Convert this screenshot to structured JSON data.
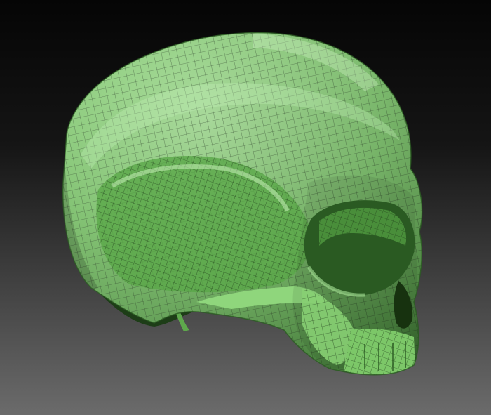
{
  "scene": {
    "subject": "skull-mesh",
    "background_top": "#050505",
    "background_bottom": "#6b6b6b",
    "mesh_base": "#6fbf5e",
    "mesh_highlight": "#a8e597",
    "mesh_shadow": "#1e4a18",
    "wire_color": "#1c3616"
  }
}
